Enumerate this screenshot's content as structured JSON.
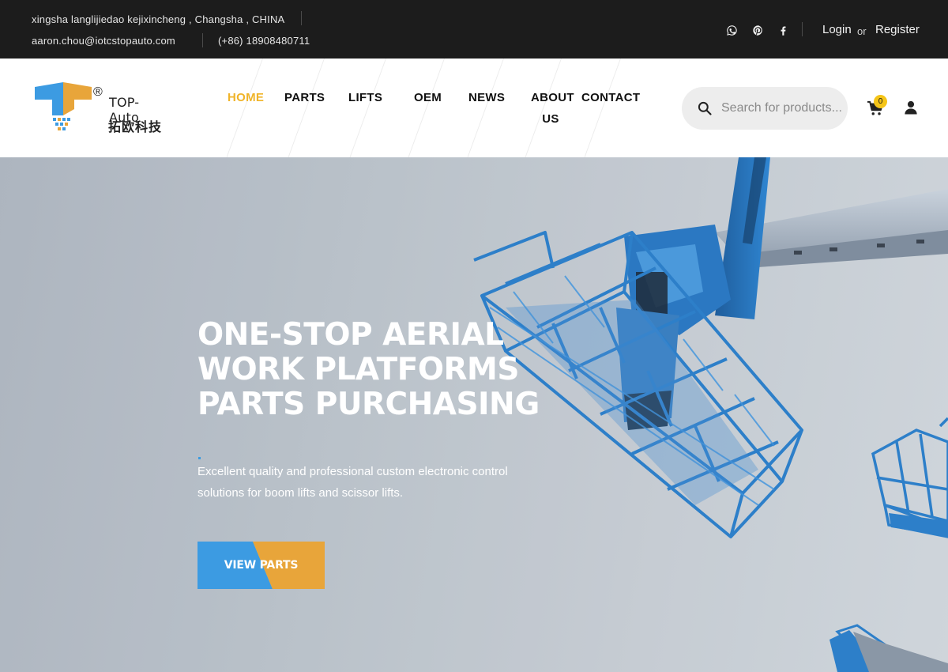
{
  "topbar": {
    "address": "xingsha langlijiedao kejixincheng , Changsha , CHINA",
    "email": "aaron.chou@iotcstopauto.com",
    "phone": "(+86) 18908480711",
    "login_label": "Login",
    "or_label": "or",
    "register_label": "Register"
  },
  "logo": {
    "name_en": "TOP-Auto",
    "name_cn": "拓欧科技",
    "registered_mark": "®"
  },
  "nav": {
    "items": [
      {
        "label": "HOME"
      },
      {
        "label": "PARTS"
      },
      {
        "label": "LIFTS"
      },
      {
        "label": "OEM"
      },
      {
        "label": "NEWS"
      },
      {
        "label": "ABOUT"
      },
      {
        "label": "US"
      },
      {
        "label": "CONTACT"
      }
    ]
  },
  "search": {
    "placeholder": "Search for products..."
  },
  "cart": {
    "count": "0"
  },
  "hero": {
    "title_lines": [
      "ONE-STOP AERIAL",
      "WORK PLATFORMS",
      "PARTS PURCHASING"
    ],
    "description": "Excellent quality and professional custom electronic control solutions for boom lifts and scissor lifts.",
    "button_label": "VIEW PARTS"
  },
  "colors": {
    "topbar_bg": "#1c1c1c",
    "nav_active": "#f0b429",
    "button_blue": "#3c9be2",
    "button_orange": "#e8a53a",
    "cart_badge": "#f5c518",
    "platform_blue": "#2d7fc9"
  },
  "icons": [
    "whatsapp-icon",
    "pinterest-icon",
    "facebook-icon",
    "search-icon",
    "cart-icon",
    "user-icon"
  ]
}
